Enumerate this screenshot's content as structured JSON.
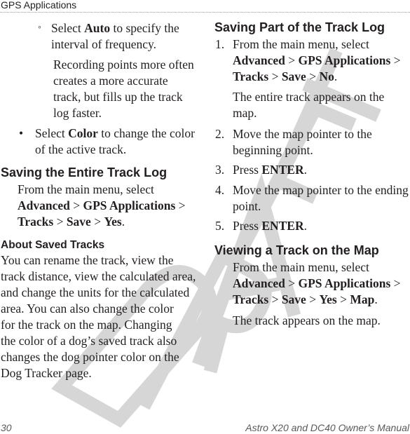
{
  "header": {
    "section_title": "GPS Applications"
  },
  "left_column": {
    "sub_bullet": {
      "marker": "◦",
      "pre": "Select ",
      "bold": "Auto",
      "post_lines": [
        " to specify the",
        "interval of frequency."
      ],
      "note_lines": [
        "Recording points more often",
        "creates a more accurate",
        "track, but fills up the track",
        "log faster."
      ]
    },
    "bullet": {
      "marker": "•",
      "pre": "Select ",
      "bold": "Color",
      "post_lines": [
        " to change the color",
        "of the active track."
      ]
    },
    "saving_entire": {
      "heading": "Saving the Entire Track Log",
      "line1": "From the main menu, select",
      "path": [
        "Advanced",
        "GPS Applications",
        "Tracks",
        "Save",
        "Yes"
      ],
      "separator": ">"
    },
    "about_saved": {
      "heading": "About Saved Tracks",
      "lines": [
        "You can rename the track, view the",
        "track distance, view the calculated area,",
        "and change the units for the calculated",
        "area. You can also change the color",
        "for the track on the map. Changing",
        "the color of a dog’s saved track also",
        "changes the dog pointer color on the",
        "Dog Tracker page."
      ]
    }
  },
  "right_column": {
    "saving_part": {
      "heading": "Saving Part of the Track Log",
      "steps": [
        {
          "num": "1.",
          "line1": "From the main menu, select",
          "path": [
            "Advanced",
            "GPS Applications",
            "Tracks",
            "Save",
            "No"
          ],
          "note_lines": [
            "The entire track appears on the",
            "map."
          ]
        },
        {
          "num": "2.",
          "lines": [
            "Move the map pointer to the",
            "beginning point."
          ]
        },
        {
          "num": "3.",
          "pre": "Press ",
          "bold": "ENTER",
          "post": "."
        },
        {
          "num": "4.",
          "lines": [
            "Move the map pointer to the ending",
            "point."
          ]
        },
        {
          "num": "5.",
          "pre": "Press ",
          "bold": "ENTER",
          "post": "."
        }
      ]
    },
    "viewing": {
      "heading": "Viewing a Track on the Map",
      "line1": "From the main menu, select",
      "path": [
        "Advanced",
        "GPS Applications",
        "Tracks",
        "Save",
        "Yes",
        "Map"
      ],
      "note": "The track appears on the map."
    }
  },
  "footer": {
    "page_number": "30",
    "manual_title": "Astro X20 and DC40 Owner’s Manual"
  },
  "watermark": {
    "text": "DRAFT",
    "color": "#d9d9d9"
  }
}
